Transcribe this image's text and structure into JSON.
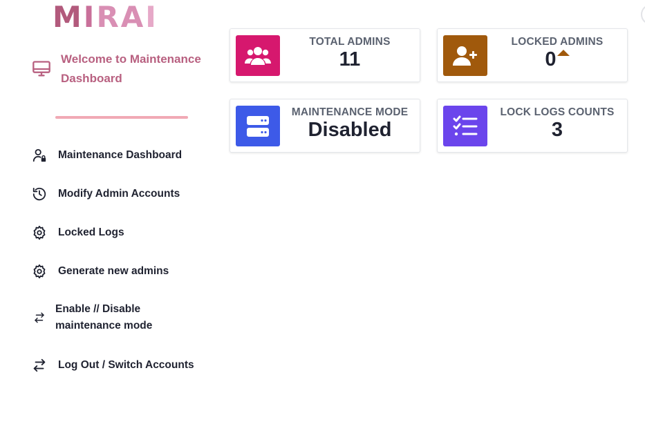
{
  "brand": {
    "logo_text": "MIRAI"
  },
  "sidebar": {
    "welcome": "Welcome to Maintenance Dashboard",
    "items": [
      {
        "label": "Maintenance Dashboard",
        "icon": "user-lock-icon"
      },
      {
        "label": "Modify Admin Accounts",
        "icon": "history-icon"
      },
      {
        "label": "Locked Logs",
        "icon": "gear-icon"
      },
      {
        "label": "Generate new admins",
        "icon": "gear-icon"
      },
      {
        "label": "Enable // Disable maintenance mode",
        "icon": "swap-arrows-icon"
      },
      {
        "label": "Log Out / Switch Accounts",
        "icon": "swap-arrows-icon"
      }
    ]
  },
  "cards": {
    "total_admins": {
      "label": "TOTAL ADMINS",
      "value": "11",
      "color": "#d6186e",
      "icon": "users-icon"
    },
    "locked_admins": {
      "label": "LOCKED ADMINS",
      "value": "0",
      "color": "#a0590c",
      "icon": "user-plus-icon"
    },
    "maintenance_mode": {
      "label": "MAINTENANCE MODE",
      "value": "Disabled",
      "color": "#3d5ae8",
      "icon": "server-icon"
    },
    "lock_logs_counts": {
      "label": "LOCK LOGS COUNTS",
      "value": "3",
      "color": "#6b45ec",
      "icon": "list-check-icon"
    }
  },
  "colors": {
    "welcome_text": "#b86080",
    "divider": "#f1a9b5",
    "nav_text": "#1f2230",
    "card_label": "#5b6270"
  }
}
